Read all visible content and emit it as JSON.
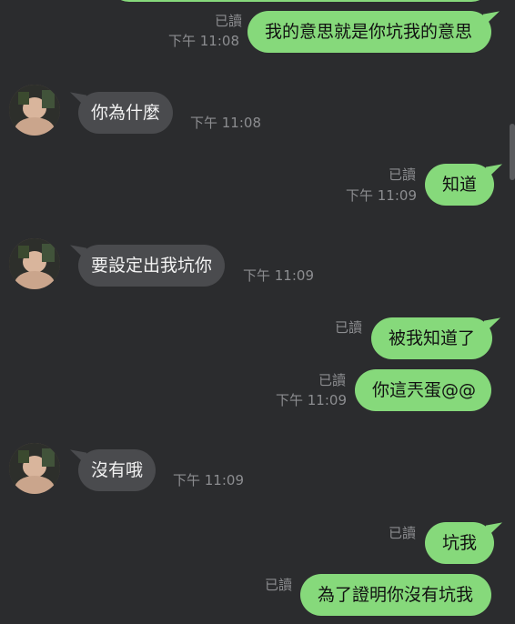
{
  "colors": {
    "background": "#2b2c2e",
    "outgoing_bubble": "#86d97b",
    "incoming_bubble": "#4a4b4e",
    "meta_text": "#8c8d90"
  },
  "icons": {
    "avatar": "contact-avatar"
  },
  "messages": [
    {
      "dir": "out",
      "text": "我的意思就是你坑我的意思",
      "read": "已讀",
      "time": "下午 11:08"
    },
    {
      "dir": "in",
      "text": "你為什麼",
      "time": "下午 11:08"
    },
    {
      "dir": "out",
      "text": "知道",
      "read": "已讀",
      "time": "下午 11:09"
    },
    {
      "dir": "in",
      "text": "要設定出我坑你",
      "time": "下午 11:09"
    },
    {
      "dir": "out",
      "text": "被我知道了",
      "read": "已讀",
      "time": ""
    },
    {
      "dir": "out",
      "text": "你這兲蛋@@",
      "read": "已讀",
      "time": "下午 11:09"
    },
    {
      "dir": "in",
      "text": "沒有哦",
      "time": "下午 11:09"
    },
    {
      "dir": "out",
      "text": "坑我",
      "read": "已讀",
      "time": ""
    },
    {
      "dir": "out",
      "text": "為了證明你沒有坑我",
      "read": "已讀",
      "time": ""
    }
  ]
}
